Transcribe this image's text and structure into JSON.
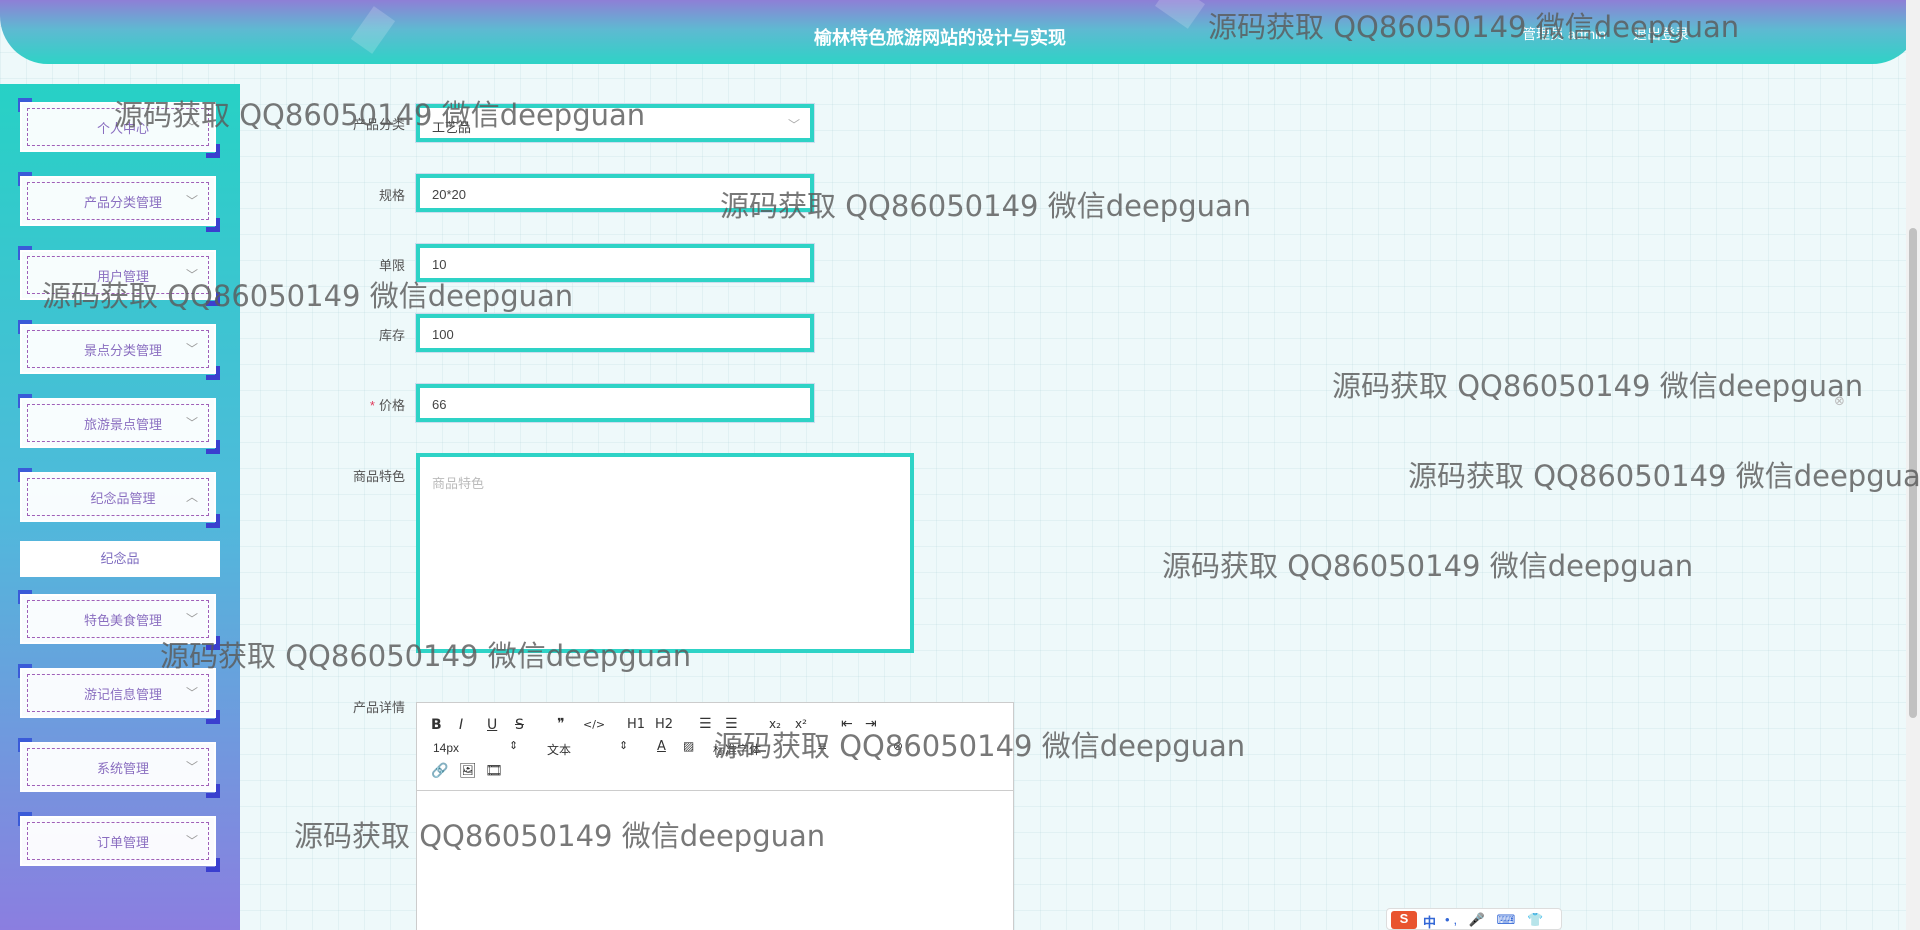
{
  "header": {
    "title": "榆林特色旅游网站的设计与实现",
    "user": "管理员 admin",
    "logout": "退出登录"
  },
  "sidebar": {
    "items": [
      {
        "label": "个人中心",
        "chevron": "chevron-down-icon"
      },
      {
        "label": "产品分类管理",
        "chevron": "chevron-down-icon"
      },
      {
        "label": "用户管理",
        "chevron": "chevron-down-icon"
      },
      {
        "label": "景点分类管理",
        "chevron": "chevron-down-icon"
      },
      {
        "label": "旅游景点管理",
        "chevron": "chevron-down-icon"
      },
      {
        "label": "纪念品管理",
        "chevron": "chevron-up-icon"
      },
      {
        "label": "特色美食管理",
        "chevron": "chevron-down-icon"
      },
      {
        "label": "游记信息管理",
        "chevron": "chevron-down-icon"
      },
      {
        "label": "系统管理",
        "chevron": "chevron-down-icon"
      },
      {
        "label": "订单管理",
        "chevron": "chevron-down-icon"
      }
    ],
    "sub_item": "纪念品"
  },
  "form": {
    "category": {
      "label": "产品分类",
      "value": "工艺品"
    },
    "spec": {
      "label": "规格",
      "value": "20*20"
    },
    "limit": {
      "label": "单限",
      "value": "10"
    },
    "stock": {
      "label": "库存",
      "value": "100"
    },
    "price": {
      "label": "价格",
      "required_mark": "*",
      "value": "66"
    },
    "features": {
      "label": "商品特色",
      "placeholder": "商品特色"
    },
    "details": {
      "label": "产品详情"
    }
  },
  "editor": {
    "font_size": "14px",
    "block_type": "文本",
    "font_family": "标准字体",
    "buttons": {
      "bold": "B",
      "italic": "I",
      "underline": "U",
      "strike": "S",
      "quote": "❞",
      "code": "</>",
      "h1": "H1",
      "h2": "H2",
      "sub": "x₂",
      "sup": "x²",
      "color": "A"
    }
  },
  "watermark": "源码获取 QQ86050149 微信deepguan",
  "ime": {
    "logo": "S",
    "mode": "中",
    "icons": "•, 🎤 ⌨ 👕 ▦"
  },
  "colors": {
    "accent": "#2ed3c6",
    "sidebar_bottom": "#8b7ee0",
    "menu_text": "#8a6ec0"
  }
}
